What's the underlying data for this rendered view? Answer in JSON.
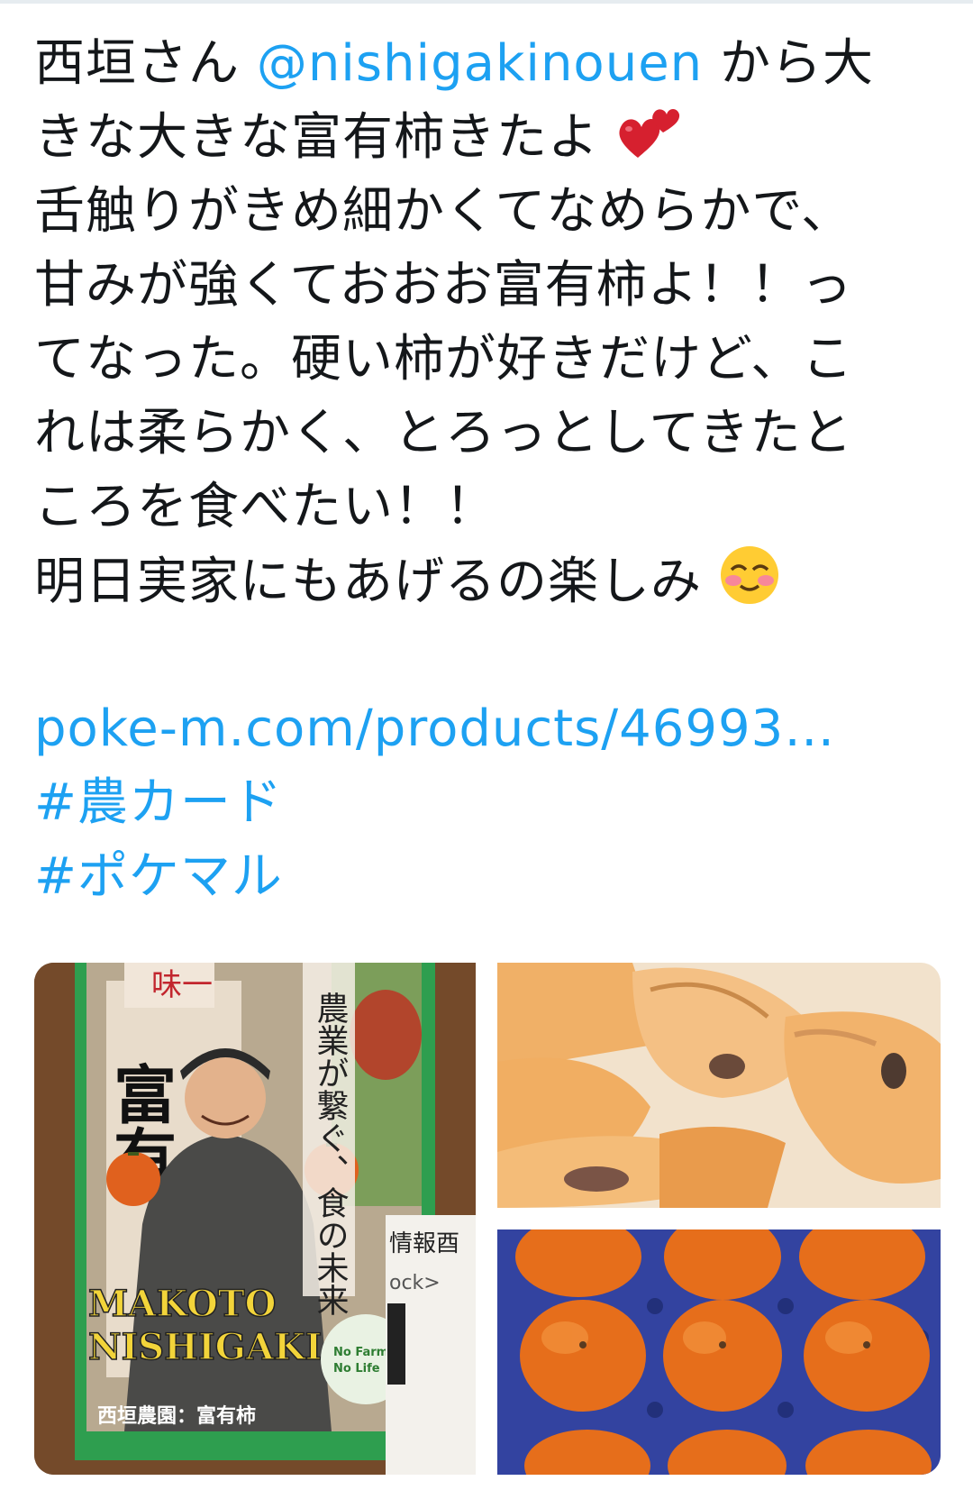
{
  "tweet": {
    "line1_before": "西垣さん",
    "mention": "@nishigakinouen",
    "line1_after": "から大",
    "line2": "きな大きな富有柿きたよ",
    "line3": "舌触りがきめ細かくてなめらかで、",
    "line4": "甘みが強くておおお富有柿よ！！っ",
    "line5": "てなった。硬い柿が好きだけど、こ",
    "line6": "れは柔らかく、とろっとしてきたと",
    "line7": "ころを食べたい！！",
    "line8": "明日実家にもあげるの楽しみ",
    "link": "poke-m.com/products/46993…",
    "hashtags": [
      "#農カード",
      "#ポケマル"
    ],
    "emojis": {
      "hearts": "two-hearts-icon",
      "smile": "smiling-face-icon"
    }
  },
  "media": {
    "card": {
      "banner": "味一",
      "big_text": "富有",
      "slogan": "農業が繋ぐ、食の未来",
      "name_line1": "MAKOTO",
      "name_line2": "NISHIGAKI",
      "farm": "西垣農園：富有柿",
      "badge_line1": "No Farmer's",
      "badge_line2": "No Life",
      "side_text1": "情報酉",
      "side_text2": "ock>"
    }
  },
  "colors": {
    "link": "#1da1f2",
    "text": "#14171a",
    "card_green": "#2e9e4f"
  }
}
